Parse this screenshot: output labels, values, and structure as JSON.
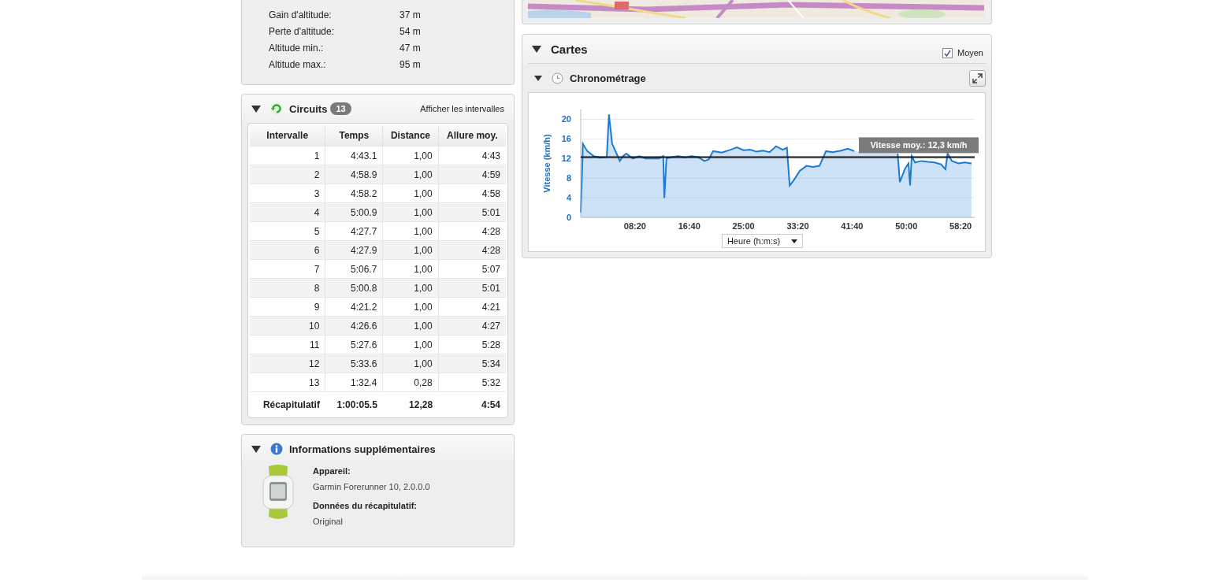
{
  "altitude_stats": [
    {
      "label": "Gain d'altitude:",
      "value": "37 m"
    },
    {
      "label": "Perte d'altitude:",
      "value": "54 m"
    },
    {
      "label": "Altitude min.:",
      "value": "47 m"
    },
    {
      "label": "Altitude max.:",
      "value": "95 m"
    }
  ],
  "circuits": {
    "title": "Circuits",
    "count": "13",
    "expanded": true,
    "link": "Afficher les intervalles",
    "table": {
      "columns": [
        "Intervalle",
        "Temps",
        "Distance",
        "Allure moy."
      ],
      "rows": [
        [
          "1",
          "4:43.1",
          "1,00",
          "4:43"
        ],
        [
          "2",
          "4:58.9",
          "1,00",
          "4:59"
        ],
        [
          "3",
          "4:58.2",
          "1,00",
          "4:58"
        ],
        [
          "4",
          "5:00.9",
          "1,00",
          "5:01"
        ],
        [
          "5",
          "4:27.7",
          "1,00",
          "4:28"
        ],
        [
          "6",
          "4:27.9",
          "1,00",
          "4:28"
        ],
        [
          "7",
          "5:06.7",
          "1,00",
          "5:07"
        ],
        [
          "8",
          "5:00.8",
          "1,00",
          "5:01"
        ],
        [
          "9",
          "4:21.2",
          "1,00",
          "4:21"
        ],
        [
          "10",
          "4:26.6",
          "1,00",
          "4:27"
        ],
        [
          "11",
          "5:27.6",
          "1,00",
          "5:28"
        ],
        [
          "12",
          "5:33.6",
          "1,00",
          "5:34"
        ],
        [
          "13",
          "1:32.4",
          "0,28",
          "5:32"
        ]
      ],
      "summary": [
        "Récapitulatif",
        "1:00:05.5",
        "12,28",
        "4:54"
      ]
    }
  },
  "info": {
    "title": "Informations supplémentaires",
    "expanded": true,
    "fields": [
      {
        "label": "Appareil:",
        "value": "Garmin Forerunner 10, 2.0.0.0"
      },
      {
        "label": "Données du récapitulatif:",
        "value": "Original"
      }
    ]
  },
  "cartes": {
    "title": "Cartes",
    "expanded": true,
    "average": {
      "label": "Moyen",
      "checked": true
    },
    "timing": {
      "title": "Chronométrage",
      "expanded": true,
      "x_axis_select": "Heure (h:m:s)",
      "chart_data": {
        "type": "area",
        "grid": true,
        "ylabel": "Vitesse (km/h)",
        "xlim": [
          0,
          3630
        ],
        "ylim": [
          0,
          22
        ],
        "yticks": [
          0,
          4,
          8,
          12,
          16,
          20
        ],
        "xticks": [
          {
            "value": 500,
            "label": "08:20"
          },
          {
            "value": 1000,
            "label": "16:40"
          },
          {
            "value": 1500,
            "label": "25:00"
          },
          {
            "value": 2000,
            "label": "33:20"
          },
          {
            "value": 2500,
            "label": "41:40"
          },
          {
            "value": 3000,
            "label": "50:00"
          },
          {
            "value": 3500,
            "label": "58:20"
          }
        ],
        "x": [
          0,
          20,
          60,
          120,
          180,
          240,
          260,
          290,
          330,
          360,
          390,
          420,
          480,
          540,
          600,
          660,
          720,
          760,
          770,
          790,
          840,
          900,
          960,
          1020,
          1080,
          1140,
          1180,
          1220,
          1300,
          1380,
          1440,
          1500,
          1560,
          1620,
          1680,
          1740,
          1800,
          1860,
          1900,
          1925,
          1960,
          2020,
          2080,
          2140,
          2200,
          2260,
          2320,
          2400,
          2460,
          2520,
          2580,
          2640,
          2700,
          2760,
          2820,
          2880,
          2920,
          2940,
          2990,
          3020,
          3035,
          3050,
          3080,
          3140,
          3200,
          3260,
          3320,
          3360,
          3380,
          3420,
          3480,
          3540,
          3600
        ],
        "series": [
          {
            "color": "#1a7ad4",
            "values": [
              1,
              15,
              13.5,
              12.5,
              12.2,
              12.3,
              21,
              15,
              13,
              11.5,
              12.5,
              13,
              12,
              12.5,
              12,
              12,
              12,
              12.5,
              4,
              12,
              12.3,
              12.5,
              12.2,
              12.5,
              12.3,
              11.5,
              11.8,
              13.5,
              13.2,
              13.8,
              14.3,
              13.7,
              13.8,
              13.4,
              13.6,
              13.3,
              14.5,
              13.8,
              14.2,
              6.5,
              7.5,
              9.5,
              10.5,
              10.3,
              10.5,
              13.5,
              13.3,
              13.6,
              14,
              13.5,
              null,
              null,
              null,
              null,
              null,
              null,
              13,
              7.2,
              10,
              11,
              6.5,
              12.5,
              11.2,
              11.5,
              11.3,
              11.2,
              10.8,
              9.8,
              13,
              11.5,
              11,
              11.2,
              11
            ]
          }
        ],
        "ref_lines": [
          {
            "axis": "y",
            "value": 12.3,
            "label": "Vitesse moy.: 12,3 km/h"
          }
        ]
      }
    }
  }
}
